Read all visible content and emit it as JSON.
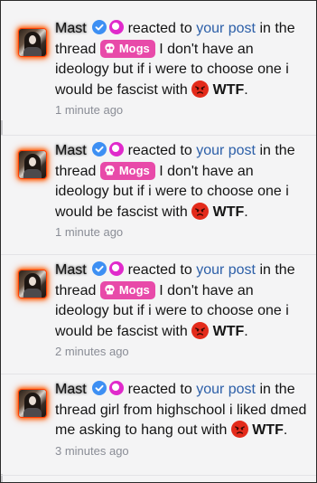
{
  "notifications": [
    {
      "username": "Mast",
      "verb": "reacted to",
      "post_link": "your post",
      "in_the_thread": "in the thread",
      "prefix_tag": "Mogs",
      "thread_title": "I don't have an ideology but if i were to choose one i would be fascist with",
      "reaction": "WTF",
      "time": "1 minute ago"
    },
    {
      "username": "Mast",
      "verb": "reacted to",
      "post_link": "your post",
      "in_the_thread": "in the thread",
      "prefix_tag": "Mogs",
      "thread_title": "I don't have an ideology but if i were to choose one i would be fascist with",
      "reaction": "WTF",
      "time": "1 minute ago"
    },
    {
      "username": "Mast",
      "verb": "reacted to",
      "post_link": "your post",
      "in_the_thread": "in the thread",
      "prefix_tag": "Mogs",
      "thread_title": "I don't have an ideology but if i were to choose one i would be fascist with",
      "reaction": "WTF",
      "time": "2 minutes ago"
    },
    {
      "username": "Mast",
      "verb": "reacted to",
      "post_link": "your post",
      "in_the_thread": "in the thread",
      "prefix_tag": "",
      "thread_title": "girl from highschool i liked dmed me asking to hang out with",
      "reaction": "WTF",
      "time": "3 minutes ago"
    }
  ],
  "colors": {
    "link": "#2c5fa8",
    "tag_background": "#e84aa9",
    "verified_badge": "#3d8ff3",
    "pink_badge": "#e02acb",
    "avatar_glow": "#ff5a00",
    "reaction_face": "#e32b1b",
    "timestamp": "#8a8d96"
  },
  "icons": {
    "verified": "verified-check-icon",
    "pink_badge": "pink-badge-icon",
    "tag": "skull-icon",
    "reaction": "angry-face-emoji"
  }
}
